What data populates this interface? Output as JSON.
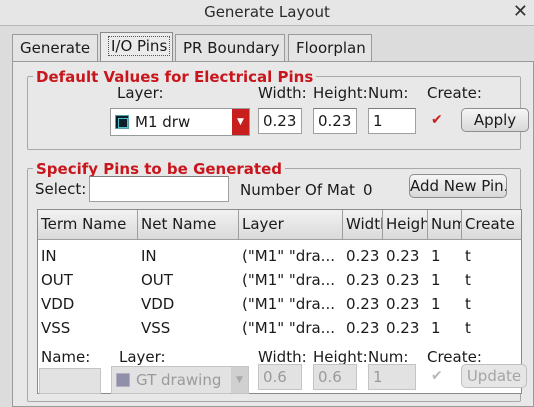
{
  "window": {
    "title": "Generate Layout",
    "close_glyph": "✕"
  },
  "tabs": [
    {
      "label": "Generate",
      "active": false
    },
    {
      "label": "I/O Pins",
      "active": true
    },
    {
      "label": "PR Boundary",
      "active": false
    },
    {
      "label": "Floorplan",
      "active": false
    }
  ],
  "defaults": {
    "title": "Default Values for Electrical Pins",
    "layer_label": "Layer:",
    "layer_value": "M1 drw",
    "width_label": "Width:",
    "width_value": "0.23",
    "height_label": "Height:",
    "height_value": "0.23",
    "num_label": "Num:",
    "num_value": "1",
    "create_label": "Create:",
    "create_checked": true,
    "apply_button": "Apply"
  },
  "specify": {
    "title": "Specify Pins to be Generated",
    "select_label": "Select:",
    "select_value": "",
    "number_of_label": "Number Of Mat",
    "number_of_value": "0",
    "add_button": "Add New Pin."
  },
  "table": {
    "columns": [
      "Term Name",
      "Net Name",
      "Layer",
      "Width",
      "Height",
      "Num",
      "Create"
    ],
    "rows": [
      [
        "IN",
        "IN",
        "(\"M1\" \"dra...",
        "0.23",
        "0.23",
        "1",
        "t"
      ],
      [
        "OUT",
        "OUT",
        "(\"M1\" \"dra...",
        "0.23",
        "0.23",
        "1",
        "t"
      ],
      [
        "VDD",
        "VDD",
        "(\"M1\" \"dra...",
        "0.23",
        "0.23",
        "1",
        "t"
      ],
      [
        "VSS",
        "VSS",
        "(\"M1\" \"dra...",
        "0.23",
        "0.23",
        "1",
        "t"
      ]
    ]
  },
  "edit": {
    "name_label": "Name:",
    "name_value": "",
    "layer_label": "Layer:",
    "layer_value": "GT drawing",
    "width_label": "Width:",
    "width_value": "0.6",
    "height_label": "Height:",
    "height_value": "0.6",
    "num_label": "Num:",
    "num_value": "1",
    "create_label": "Create:",
    "update_button": "Update"
  },
  "icons": {
    "checkmark": "✔",
    "dropdown": "▼"
  },
  "colors": {
    "accent_red": "#c8161d"
  }
}
